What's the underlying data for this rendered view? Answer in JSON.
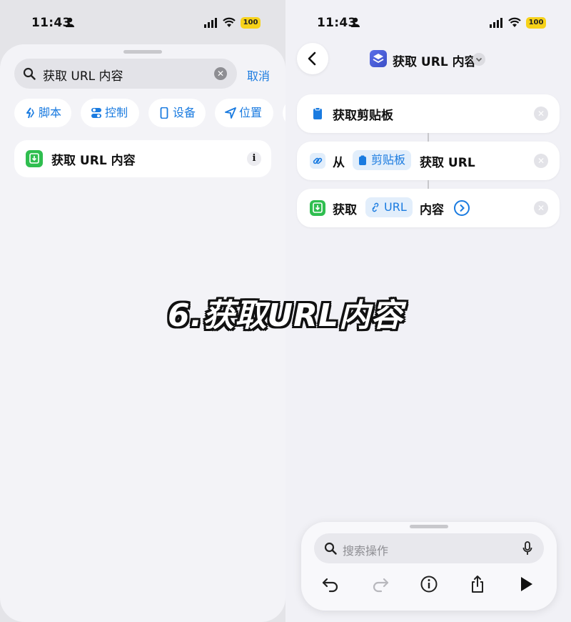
{
  "left": {
    "status": {
      "time": "11:43",
      "battery": "100"
    },
    "search": {
      "query": "获取 URL 内容",
      "cancel": "取消"
    },
    "chips": [
      {
        "label": "脚本",
        "icon": "script-icon"
      },
      {
        "label": "控制",
        "icon": "toggle-icon"
      },
      {
        "label": "设备",
        "icon": "device-icon"
      },
      {
        "label": "位置",
        "icon": "location-icon"
      }
    ],
    "result": {
      "label": "获取 URL 内容",
      "info": "i"
    }
  },
  "right": {
    "status": {
      "time": "11:43",
      "battery": "100"
    },
    "title": "获取 URL 内容",
    "actions": [
      {
        "text": "获取剪贴板"
      },
      {
        "prefix": "从",
        "token": "剪贴板",
        "suffix": "获取 URL"
      },
      {
        "prefix": "获取",
        "token": "URL",
        "suffix": "内容"
      }
    ],
    "bottom": {
      "search_placeholder": "搜索操作"
    }
  },
  "overlay": "6.获取URL内容",
  "colors": {
    "accent": "#1a7be0",
    "green": "#2fbe4f",
    "battery": "#f7d21a"
  }
}
